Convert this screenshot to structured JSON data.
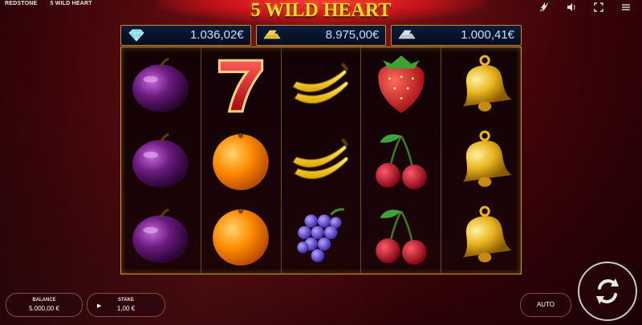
{
  "header": {
    "provider": "REDSTONE",
    "game_name": "5 WILD HEART",
    "icons": [
      "lightning-icon",
      "speaker-icon",
      "fullscreen-icon",
      "menu-icon"
    ]
  },
  "title": "5 WILD HEART",
  "jackpots": [
    {
      "icon": "diamond-icon",
      "value": "1.036,02€"
    },
    {
      "icon": "gold-bar-icon",
      "value": "8.975,00€"
    },
    {
      "icon": "silver-bar-icon",
      "value": "1.000,41€"
    }
  ],
  "reels": [
    [
      "plum",
      "plum",
      "plum"
    ],
    [
      "seven",
      "orange",
      "orange"
    ],
    [
      "banana",
      "banana",
      "grapes"
    ],
    [
      "strawberry",
      "cherry",
      "cherry"
    ],
    [
      "bell",
      "bell",
      "bell"
    ]
  ],
  "controls": {
    "balance_label": "BALANCE",
    "balance_value": "5.000,00 €",
    "stake_label": "STAKE",
    "stake_value": "1,00 €",
    "auto_label": "AUTO"
  },
  "colors": {
    "title_gold": "#ffd23a",
    "frame_gold": "#c59a2a",
    "jackpot_text": "#bfe0ff"
  }
}
